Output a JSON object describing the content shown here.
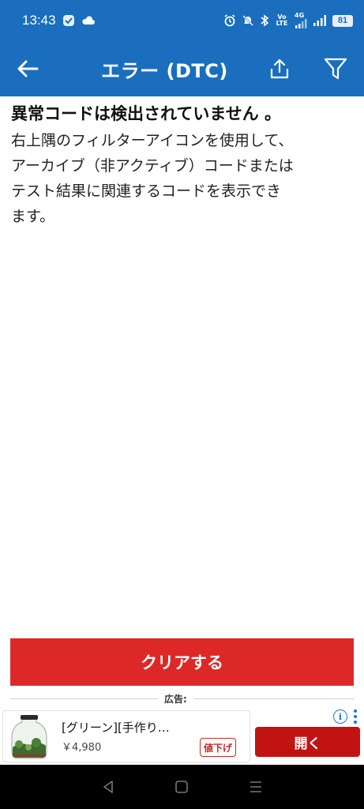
{
  "status_bar": {
    "time": "13:43",
    "network_label": "Vo LTE",
    "signal_label": "4G",
    "battery": "81",
    "icons": [
      "app-notification-icon",
      "cloud-icon",
      "alarm-icon",
      "mute-icon",
      "bluetooth-icon",
      "volte-icon",
      "signal-icon",
      "battery-icon"
    ]
  },
  "app_bar": {
    "title": "エラー (DTC)",
    "colors": {
      "primary": "#1a6ebd"
    }
  },
  "content": {
    "headline": "異常コードは検出されていません 。",
    "body_lines": [
      "右上隅のフィルターアイコンを使用して、",
      "アーカイブ（非アクティブ）コードまたは",
      "テスト結果に関連するコードを表示でき",
      "ます。"
    ]
  },
  "actions": {
    "clear_label": "クリアする",
    "clear_color": "#dd2828"
  },
  "ad": {
    "label": "広告:",
    "title": "[グリーン][手作り…",
    "price": "￥4,980",
    "badge": "値下げ",
    "open_label": "開く",
    "info_glyph": "i"
  }
}
